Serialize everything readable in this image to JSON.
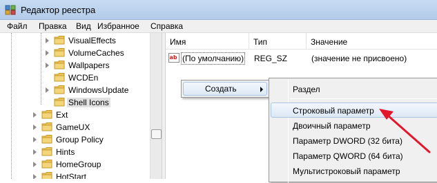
{
  "window": {
    "title": "Редактор реестра"
  },
  "menubar": {
    "items": [
      "Файл",
      "Правка",
      "Вид",
      "Избранное",
      "Справка"
    ]
  },
  "tree": {
    "items": [
      {
        "label": "VisualEffects"
      },
      {
        "label": "VolumeCaches"
      },
      {
        "label": "Wallpapers"
      },
      {
        "label": "WCDEn"
      },
      {
        "label": "WindowsUpdate"
      },
      {
        "label": "Shell Icons",
        "selected": true
      },
      {
        "label": "Ext"
      },
      {
        "label": "GameUX"
      },
      {
        "label": "Group Policy"
      },
      {
        "label": "Hints"
      },
      {
        "label": "HomeGroup"
      },
      {
        "label": "HotStart"
      }
    ]
  },
  "list": {
    "columns": [
      "Имя",
      "Тип",
      "Значение"
    ],
    "rows": [
      {
        "name": "(По умолчанию)",
        "type": "REG_SZ",
        "value": "(значение не присвоено)"
      }
    ]
  },
  "context_menu": {
    "create_label": "Создать"
  },
  "submenu": {
    "items": [
      "Раздел",
      "Строковый параметр",
      "Двоичный параметр",
      "Параметр DWORD (32 бита)",
      "Параметр QWORD (64 бита)",
      "Мультистроковый параметр"
    ],
    "highlighted": "Строковый параметр"
  },
  "colors": {
    "folder": "#e8c25a",
    "arrow": "#e3162b",
    "selection": "#dde8f6"
  },
  "icons": [
    "registry-app-icon",
    "folder-icon",
    "tree-expand-arrow-icon",
    "string-value-icon",
    "submenu-arrow-icon",
    "red-pointer-arrow"
  ]
}
